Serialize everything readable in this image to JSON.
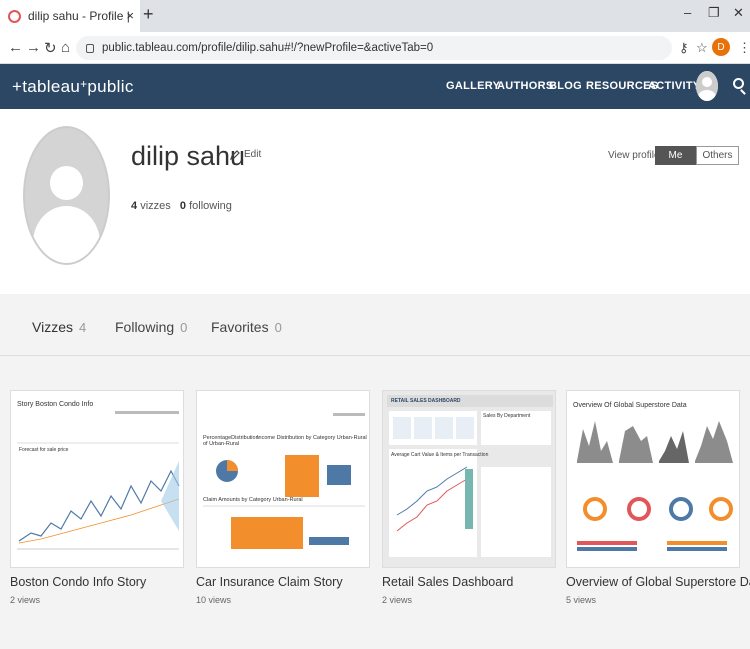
{
  "browser": {
    "tab_title": "dilip sahu - Profile | Tableau Publ",
    "tab_close": "×",
    "new_tab": "+",
    "url": "public.tableau.com/profile/dilip.sahu#!/?newProfile=&activeTab=0",
    "profile_initial": "D",
    "win_min": "–",
    "win_max": "❐",
    "win_close": "✕"
  },
  "header": {
    "logo": "+tableau+public",
    "logo_left": "+tableau",
    "logo_right": "public",
    "nav": [
      "GALLERY",
      "AUTHORS",
      "BLOG",
      "RESOURCES",
      "ACTIVITY"
    ]
  },
  "profile": {
    "name": "dilip sahu",
    "edit_label": "Edit",
    "vizzes_count": "4",
    "vizzes_label": "vizzes",
    "following_count": "0",
    "following_label": "following",
    "view_as_label": "View profile as",
    "view_as_options": [
      "Me",
      "Others"
    ],
    "view_as_selected": "Me"
  },
  "tabs": [
    {
      "label": "Vizzes",
      "count": "4"
    },
    {
      "label": "Following",
      "count": "0"
    },
    {
      "label": "Favorites",
      "count": "0"
    }
  ],
  "cards": [
    {
      "title": "Boston Condo Info Story",
      "views": "2 views",
      "thumb_title": "Story Boston Condo Info",
      "thumb_sub": "Forecast for sale price"
    },
    {
      "title": "Car Insurance Claim Story",
      "views": "10 views",
      "thumb_title": "PercentageDistribution of Urban-Rural",
      "thumb_sub": "Income Distribution by Category Urban-Rural",
      "thumb_sub2": "Claim Amounts by Category Urban-Rural"
    },
    {
      "title": "Retail Sales Dashboard",
      "views": "2 views",
      "thumb_title": "RETAIL SALES DASHBOARD",
      "thumb_sub": "Average Cart Value & Items per Transaction",
      "thumb_sub2": "Sales By Department"
    },
    {
      "title": "Overview of Global Superstore Data",
      "views": "5 views",
      "thumb_title": "Overview Of Global Superstore Data"
    }
  ],
  "colors": {
    "header_bg": "#2c4764",
    "accent_orange": "#f28e2b",
    "accent_blue": "#4e79a7",
    "accent_red": "#e15759"
  }
}
